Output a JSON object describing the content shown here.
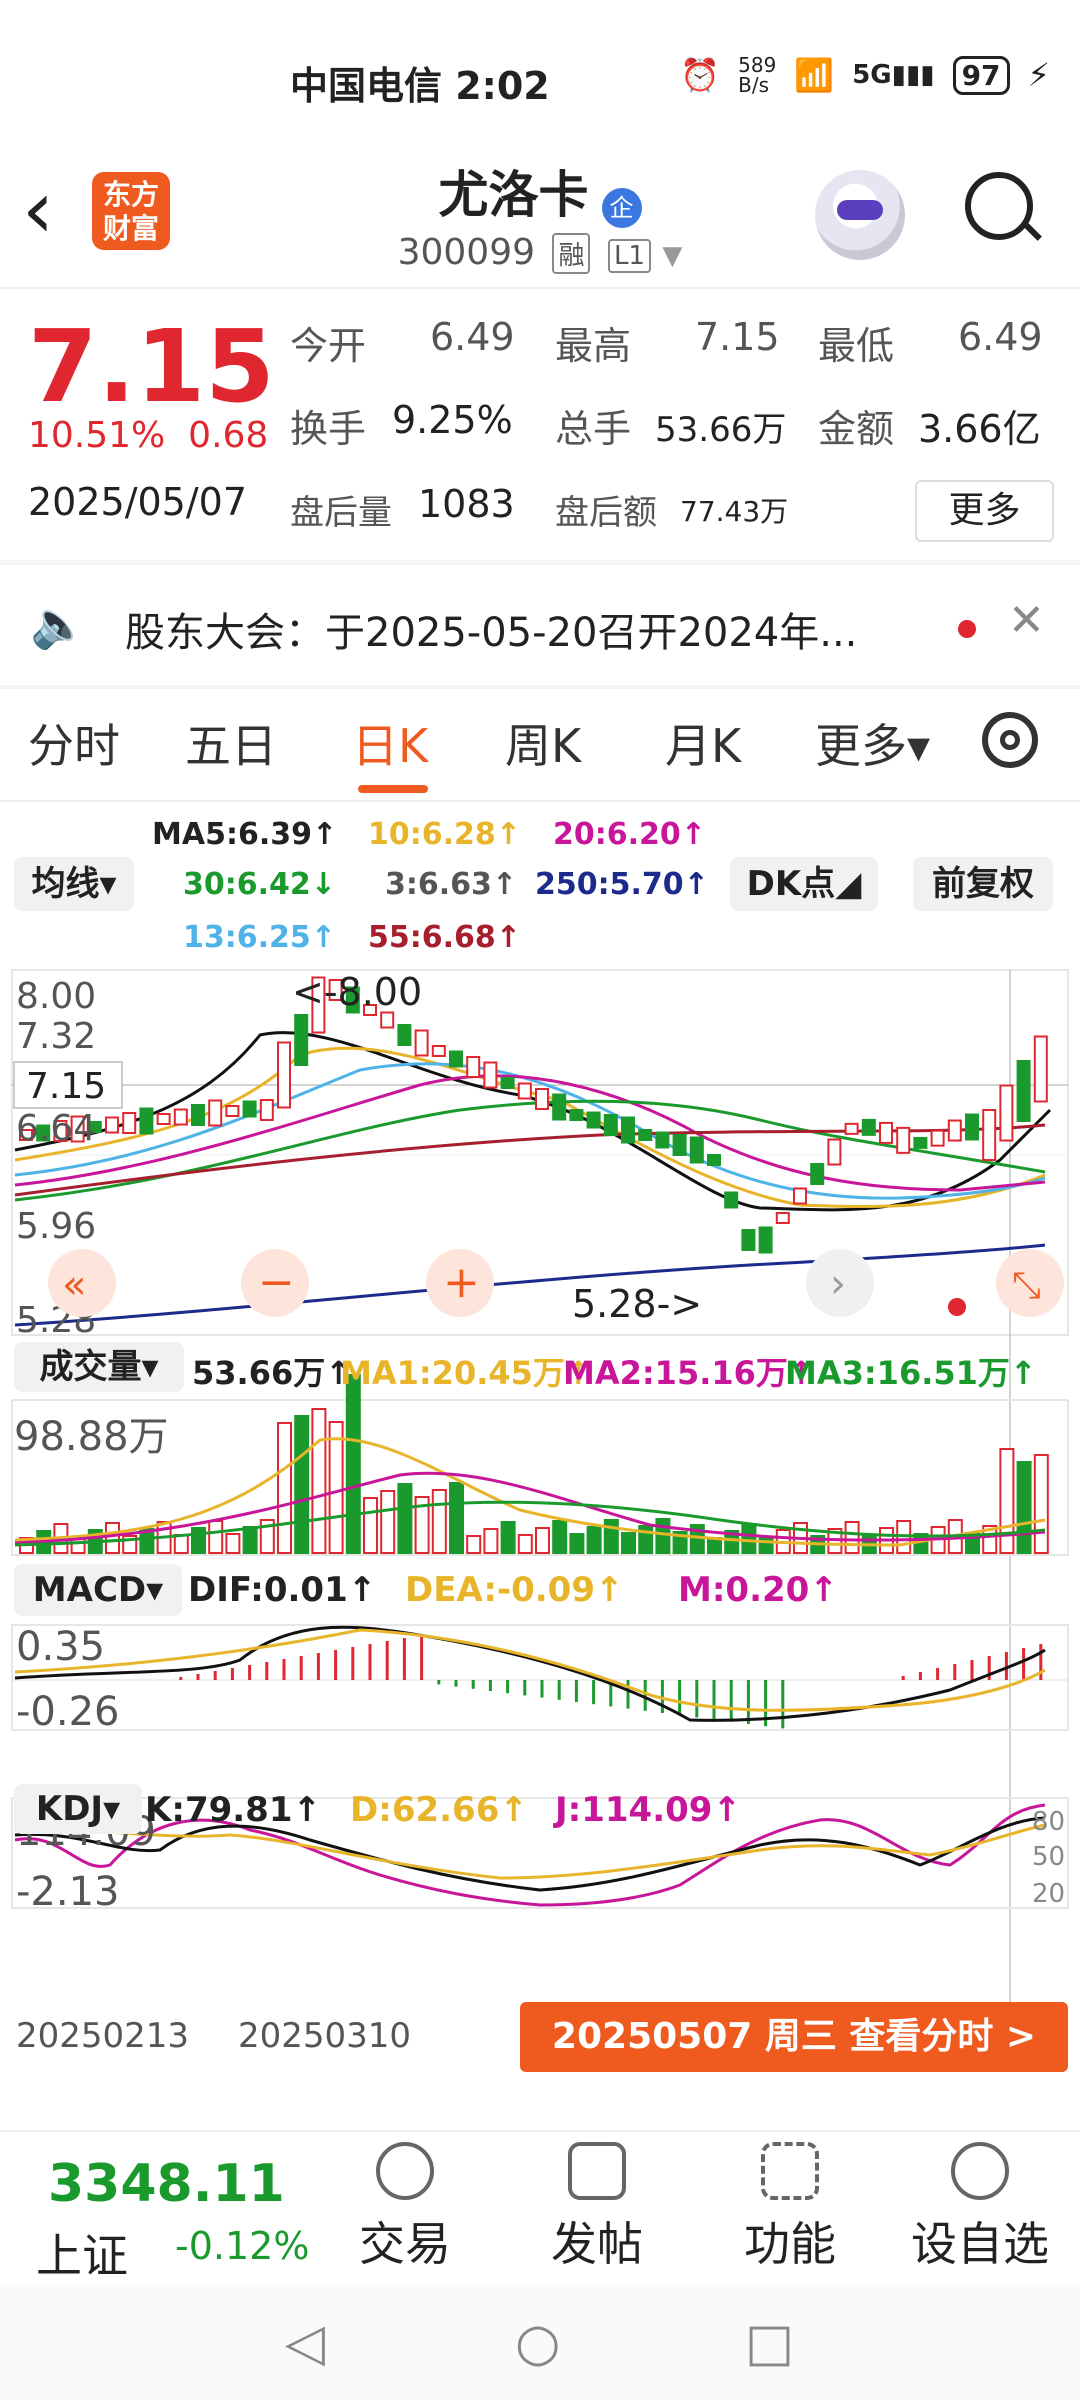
{
  "status_bar": {
    "carrier_time": "中国电信 2:02",
    "network_speed": "589\nB/s",
    "battery": "97"
  },
  "header": {
    "logo_text": "东方\n财富",
    "stock_name": "尤洛卡",
    "enterprise_badge": "企",
    "stock_code": "300099",
    "tag_margin": "融",
    "tag_level": "L1"
  },
  "quote": {
    "price": "7.15",
    "change_pct": "10.51%",
    "change_amt": "0.68",
    "date": "2025/05/07",
    "open_label": "今开",
    "open": "6.49",
    "high_label": "最高",
    "high": "7.15",
    "low_label": "最低",
    "low": "6.49",
    "turnover_label": "换手",
    "turnover": "9.25%",
    "volume_label": "总手",
    "volume": "53.66万",
    "amount_label": "金额",
    "amount": "3.66亿",
    "after_vol_label": "盘后量",
    "after_vol": "1083",
    "after_amt_label": "盘后额",
    "after_amt": "77.43万",
    "more_button": "更多"
  },
  "notice": {
    "text": "股东大会：于2025-05-20召开2024年..."
  },
  "tabs": [
    {
      "label": "分时"
    },
    {
      "label": "五日"
    },
    {
      "label": "日K"
    },
    {
      "label": "周K"
    },
    {
      "label": "月K"
    },
    {
      "label": "更多▾"
    }
  ],
  "ma_legend": {
    "ma5": "MA5:6.39↑",
    "ma10": "10:6.28↑",
    "ma20": "20:6.20↑",
    "ma30": "30:6.42↓",
    "ma3": "3:6.63↑",
    "ma250": "250:5.70↑",
    "ma13": "13:6.25↑",
    "ma55": "55:6.68↑",
    "junxian_select": "均线▾",
    "dk_select": "DK点◢",
    "fuquan": "前复权"
  },
  "kline": {
    "y_labels": [
      "8.00",
      "7.32",
      "6.64",
      "5.96",
      "5.28"
    ],
    "current_price_tag": "7.15",
    "high_marker": "<-8.00",
    "low_marker": "5.28->"
  },
  "volume_panel": {
    "select": "成交量▾",
    "vol": "53.66万↑",
    "ma1": "MA1:20.45万↑",
    "ma2": "MA2:15.16万↑",
    "ma3": "MA3:16.51万↑",
    "y_max": "98.88万"
  },
  "macd_panel": {
    "select": "MACD▾",
    "dif": "DIF:0.01↑",
    "dea": "DEA:-0.09↑",
    "m": "M:0.20↑",
    "y_top": "0.35",
    "y_bottom": "-0.26"
  },
  "kdj_panel": {
    "select": "KDJ▾",
    "k": "K:79.81↑",
    "d": "D:62.66↑",
    "j": "J:114.09↑",
    "y_top": "114.09",
    "y_bottom": "-2.13",
    "r80": "80",
    "r50": "50",
    "r20": "20"
  },
  "x_axis": {
    "d1": "20250213",
    "d2": "20250310",
    "view_fenshi": "20250507 周三 查看分时 >"
  },
  "bottom_bar": {
    "index_value": "3348.11",
    "index_name": "上证",
    "index_change": "-0.12%",
    "items": [
      {
        "label": "交易"
      },
      {
        "label": "发帖"
      },
      {
        "label": "功能"
      },
      {
        "label": "设自选"
      }
    ]
  },
  "colors": {
    "up": "#e0262f",
    "down": "#1a9a2c",
    "accent": "#ef5a1f"
  }
}
